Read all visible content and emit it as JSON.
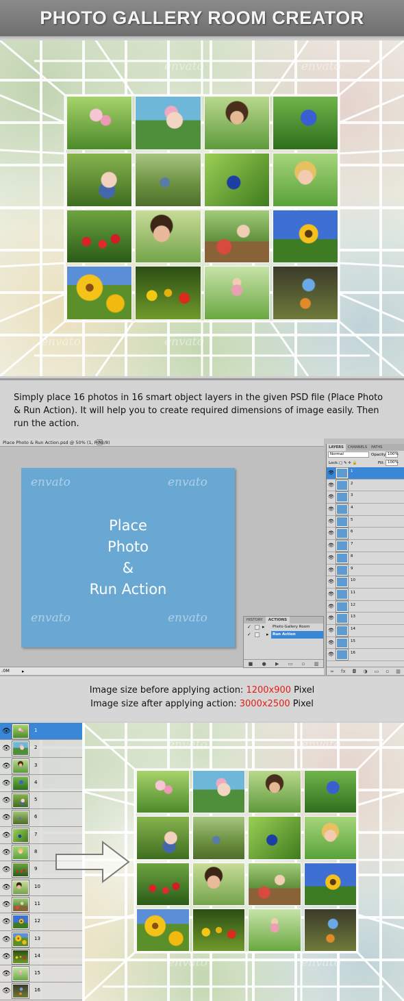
{
  "header": {
    "title": "PHOTO GALLERY ROOM CREATOR"
  },
  "watermark": "envato",
  "photos": [
    {
      "name": "pink-tulips-photo",
      "style": "p-tulips"
    },
    {
      "name": "girl-bubbles-photo",
      "style": "p-bubble"
    },
    {
      "name": "curly-girl-photo",
      "style": "p-curly"
    },
    {
      "name": "blue-flower-photo",
      "style": "p-blueflw"
    },
    {
      "name": "girl-blowing-photo",
      "style": "p-blow"
    },
    {
      "name": "boy-grass-photo",
      "style": "p-boy"
    },
    {
      "name": "blue-bird-photo",
      "style": "p-bird"
    },
    {
      "name": "girl-lying-photo",
      "style": "p-girllay"
    },
    {
      "name": "red-tulips-photo",
      "style": "p-redtul"
    },
    {
      "name": "boy-dandelion-photo",
      "style": "p-dandel"
    },
    {
      "name": "girl-watermelon-photo",
      "style": "p-melon"
    },
    {
      "name": "sunflower-photo",
      "style": "p-sunfl"
    },
    {
      "name": "yellow-flowers-photo",
      "style": "p-yellow"
    },
    {
      "name": "yellow-tulips-photo",
      "style": "p-yeltul"
    },
    {
      "name": "girl-on-grass-photo",
      "style": "p-girlgr"
    },
    {
      "name": "butterfly-photo",
      "style": "p-butterfly"
    }
  ],
  "description": "Simply place 16 photos in 16 smart object layers in the given PSD file (Place Photo & Run Action). It will help you to create required dimensions of image easily. Then run the action.",
  "photoshop": {
    "doc_tab": "Place Photo & Run Action.psd @ 50% (1, RGB/8)",
    "close_glyph": "×",
    "canvas_text": "Place\nPhoto\n&\nRun Action",
    "status_zoom": ".0M",
    "status_arrow": "▸",
    "layers_panel": {
      "tabs": [
        "LAYERS",
        "CHANNELS",
        "PATHS"
      ],
      "blend_mode": "Normal",
      "opacity_label": "Opacity:",
      "opacity_value": "100%",
      "lock_label": "Lock:",
      "fill_label": "Fill:",
      "fill_value": "100%",
      "layers": [
        "1",
        "2",
        "3",
        "4",
        "5",
        "6",
        "7",
        "8",
        "9",
        "10",
        "11",
        "12",
        "13",
        "14",
        "15",
        "16"
      ],
      "selected_index": 0
    },
    "actions_panel": {
      "tabs": [
        "HISTORY",
        "ACTIONS"
      ],
      "active_tab": "ACTIONS",
      "set_name": "Photo Gallery Room Crea...",
      "action_name": "Run Action",
      "check_glyph": "✓",
      "fold_glyph": "▸"
    }
  },
  "size_info": {
    "before_label": "Image size before applying action: ",
    "before_value": "1200x900",
    "before_unit": " Pixel",
    "after_label": "Image size after applying action: ",
    "after_value": "3000x2500",
    "after_unit": " Pixel"
  },
  "bottom_layers": {
    "labels": [
      "1",
      "2",
      "3",
      "4",
      "5",
      "6",
      "7",
      "8",
      "9",
      "10",
      "11",
      "12",
      "13",
      "14",
      "15",
      "16"
    ],
    "selected_index": 0
  },
  "icons": {
    "eye": "👁"
  },
  "colors": {
    "highlight_red": "#e41b13",
    "selection_blue": "#3a87d8",
    "canvas_blue": "#6aa8d4"
  }
}
